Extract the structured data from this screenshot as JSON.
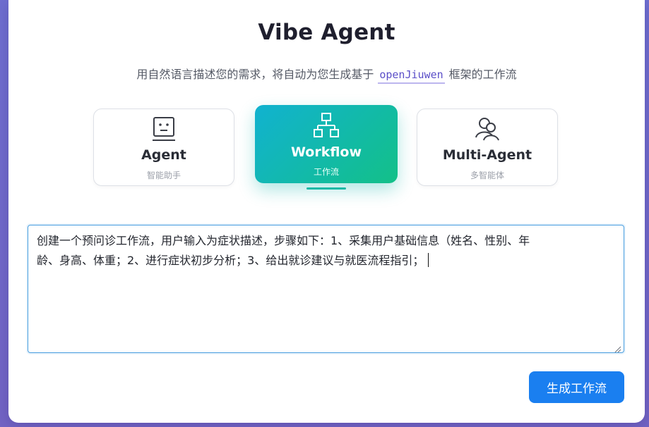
{
  "header": {
    "title": "Vibe Agent",
    "subtitle_before": "用自然语言描述您的需求，将自动为您生成基于",
    "subtitle_code": "openJiuwen",
    "subtitle_after": "框架的工作流"
  },
  "modes": [
    {
      "name": "Agent",
      "desc": "智能助手",
      "icon": "robot-face-icon",
      "active": false
    },
    {
      "name": "Workflow",
      "desc": "工作流",
      "icon": "workflow-hierarchy-icon",
      "active": true
    },
    {
      "name": "Multi-Agent",
      "desc": "多智能体",
      "icon": "users-icon",
      "active": false
    }
  ],
  "input": {
    "line1": "创建一个预问诊工作流，用户输入为症状描述，步骤如下：1、采集用户基础信息（姓名、性别、年",
    "line2": "龄、身高、体重；2、进行症状初步分析；3、给出就诊建议与就医流程指引；"
  },
  "actions": {
    "generate_label": "生成工作流"
  },
  "colors": {
    "accent": "#1a7ff0",
    "active_gradient_start": "#11b2d0",
    "active_gradient_end": "#13c088",
    "background": "#6f6fd0"
  }
}
